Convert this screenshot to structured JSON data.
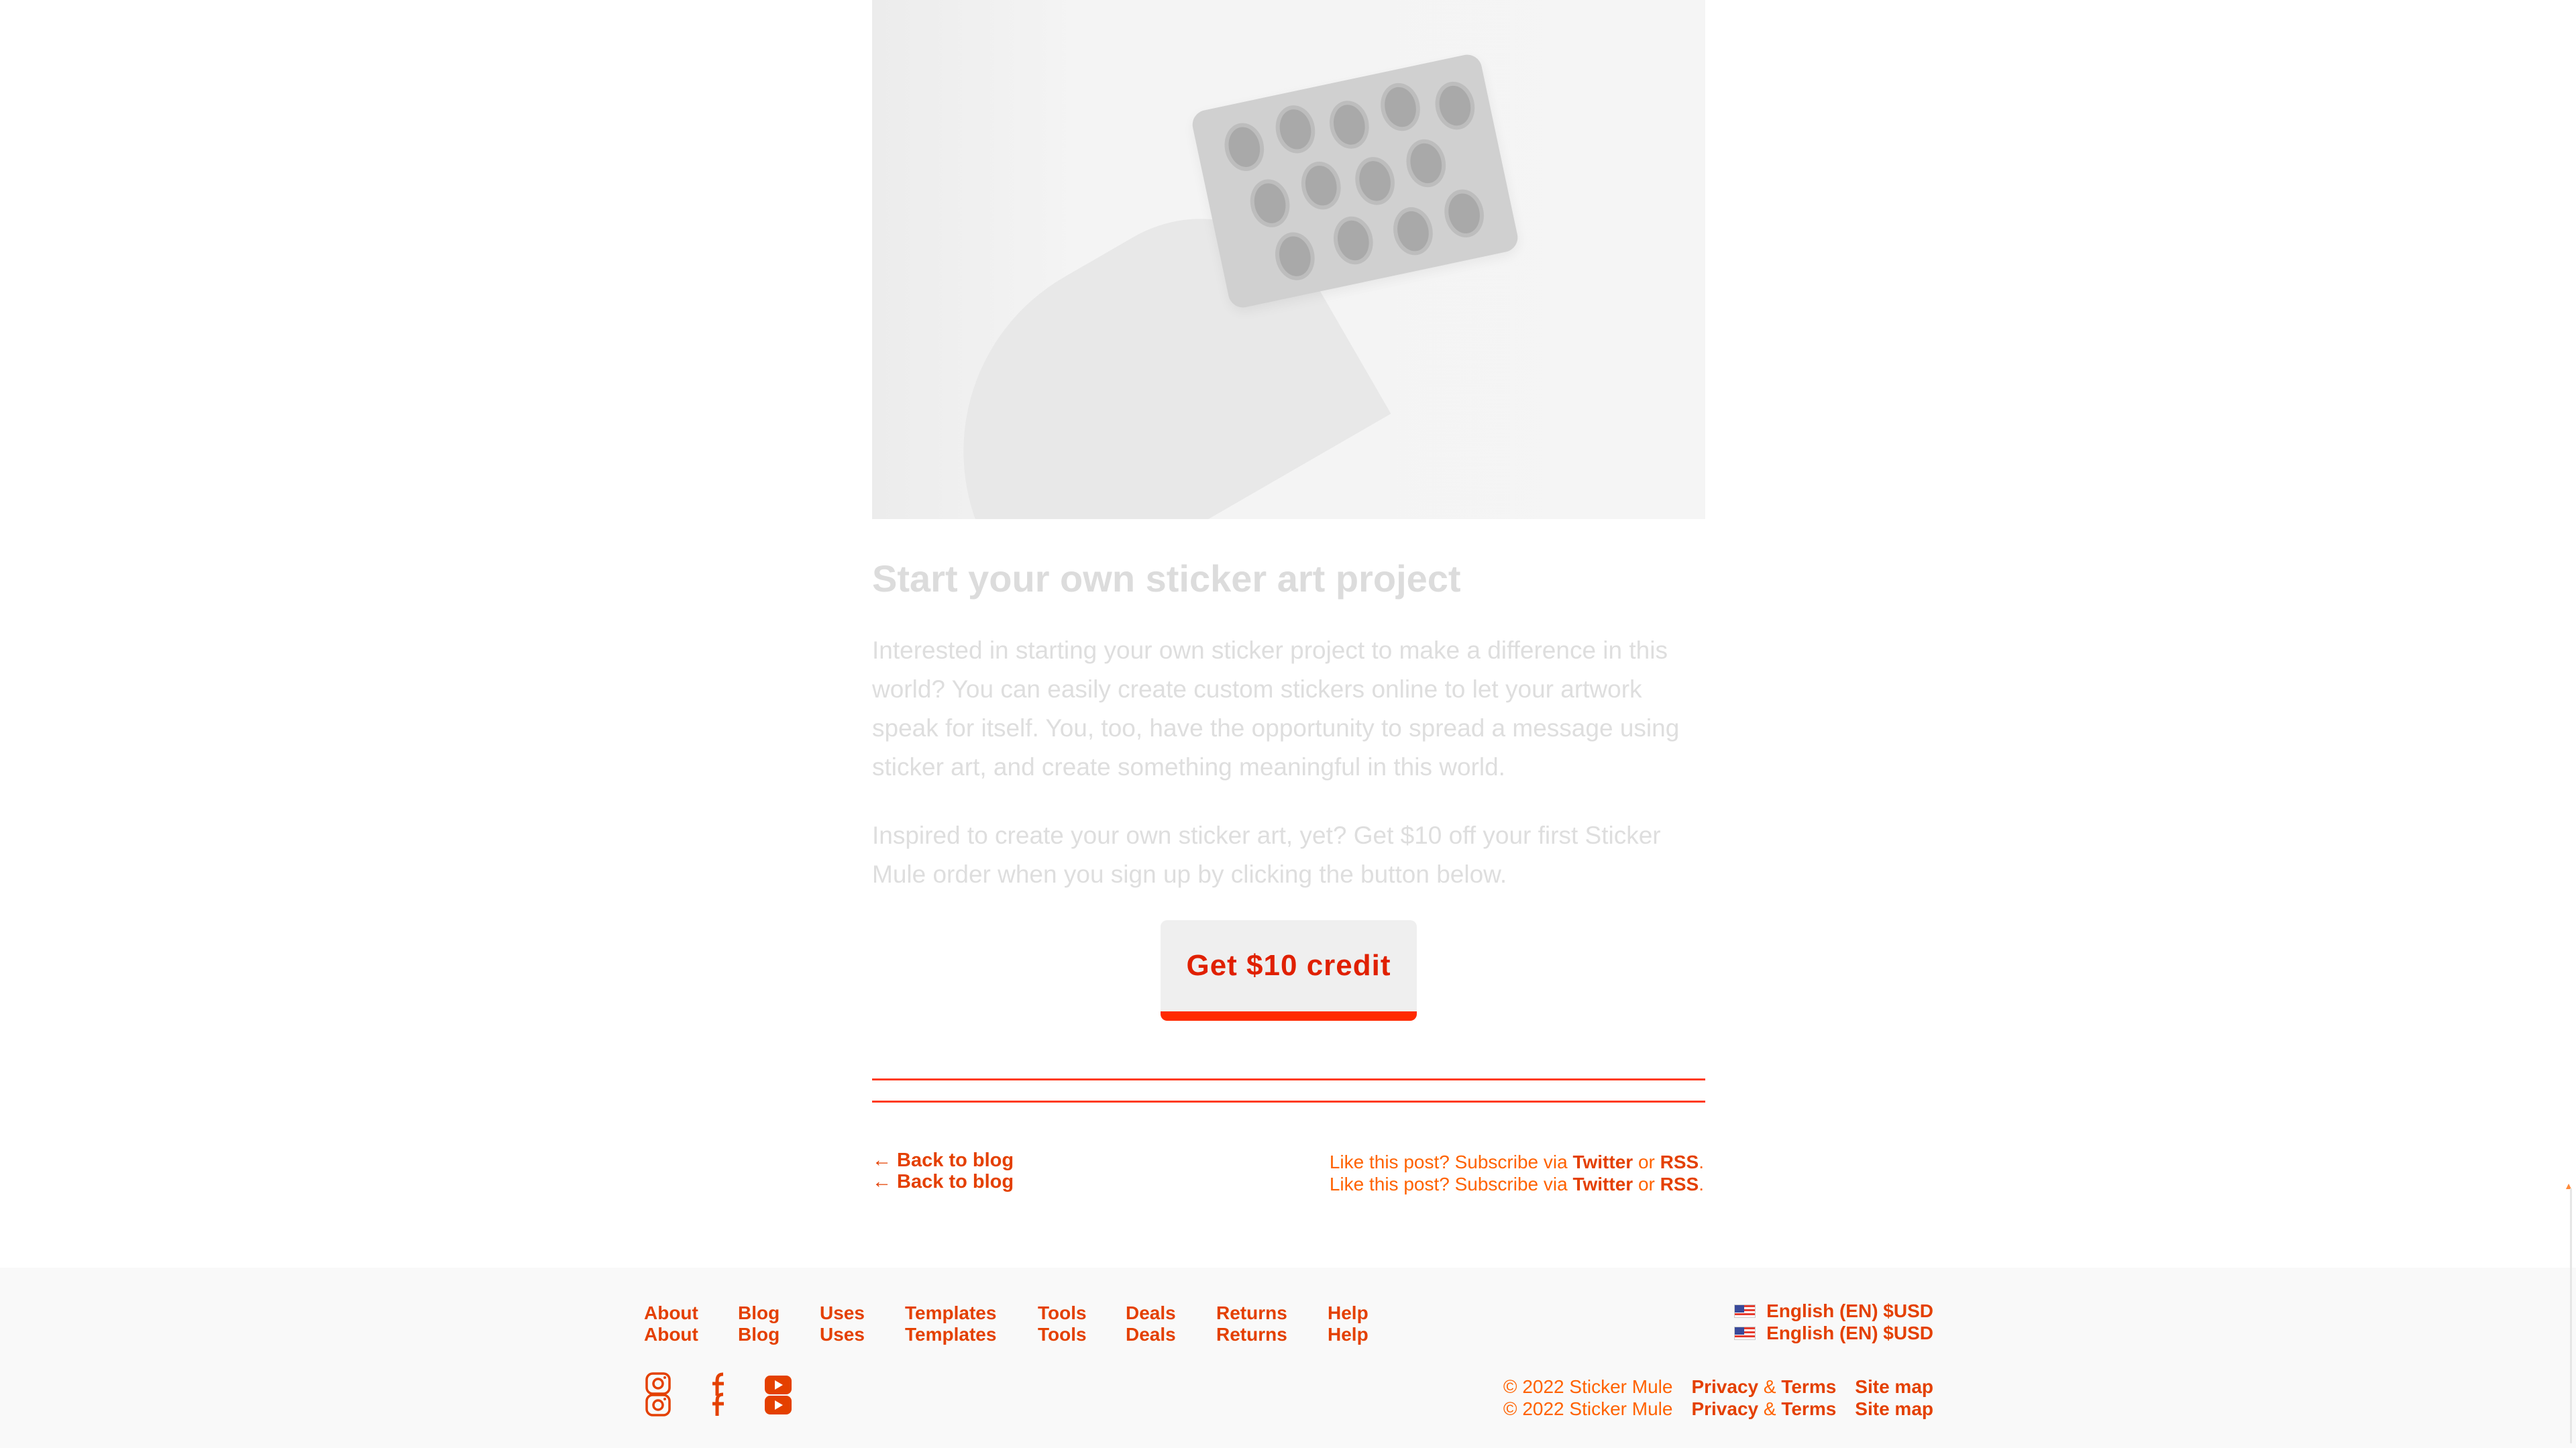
{
  "hero": {
    "image_icon": "sticker-photo-image"
  },
  "article": {
    "heading": "Start your own sticker art project",
    "paragraph_1": "Interested in starting your own sticker project to make a difference in this world? You can easily create custom stickers online to let your artwork speak for itself. You, too, have the opportunity to spread a message using sticker art, and create something meaningful in this world.",
    "paragraph_2": "Inspired to create your own sticker art, yet? Get $10 off your first Sticker Mule order when you sign up by clicking the button below.",
    "cta_label": "Get $10 credit"
  },
  "post_nav": {
    "back_label": "← Back to blog",
    "subscribe_prefix": "Like this post? Subscribe via ",
    "twitter_label": "Twitter",
    "or_label": " or ",
    "rss_label": "RSS",
    "period": "."
  },
  "footer": {
    "nav": [
      {
        "label": "About"
      },
      {
        "label": "Blog"
      },
      {
        "label": "Uses"
      },
      {
        "label": "Templates"
      },
      {
        "label": "Tools"
      },
      {
        "label": "Deals"
      },
      {
        "label": "Returns"
      },
      {
        "label": "Help"
      }
    ],
    "language_label": "English (EN) $USD",
    "copyright": "© 2022 Sticker Mule",
    "privacy_label": "Privacy",
    "amp": " & ",
    "terms_label": "Terms",
    "sitemap_label": "Site map",
    "social_icons": [
      "instagram-icon",
      "facebook-icon",
      "youtube-icon"
    ]
  },
  "colors": {
    "accent": "#ff3a00",
    "link": "#e44000",
    "muted_text": "#dedede",
    "footer_bg": "#f9f9f9"
  }
}
